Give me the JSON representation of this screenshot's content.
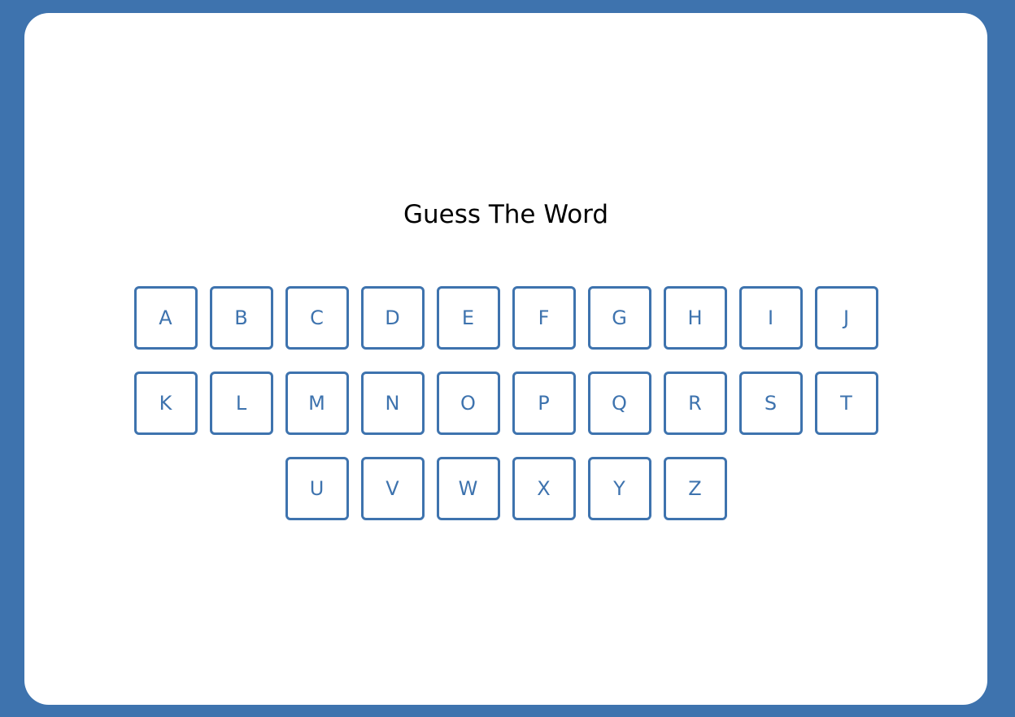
{
  "title": "Guess The Word",
  "colors": {
    "background": "#3e73ae",
    "card": "#ffffff",
    "key_border": "#3e73ae",
    "key_text": "#3e73ae",
    "title_text": "#000000"
  },
  "keyboard": {
    "rows": [
      [
        "A",
        "B",
        "C",
        "D",
        "E",
        "F",
        "G",
        "H",
        "I",
        "J"
      ],
      [
        "K",
        "L",
        "M",
        "N",
        "O",
        "P",
        "Q",
        "R",
        "S",
        "T"
      ],
      [
        "U",
        "V",
        "W",
        "X",
        "Y",
        "Z"
      ]
    ]
  }
}
